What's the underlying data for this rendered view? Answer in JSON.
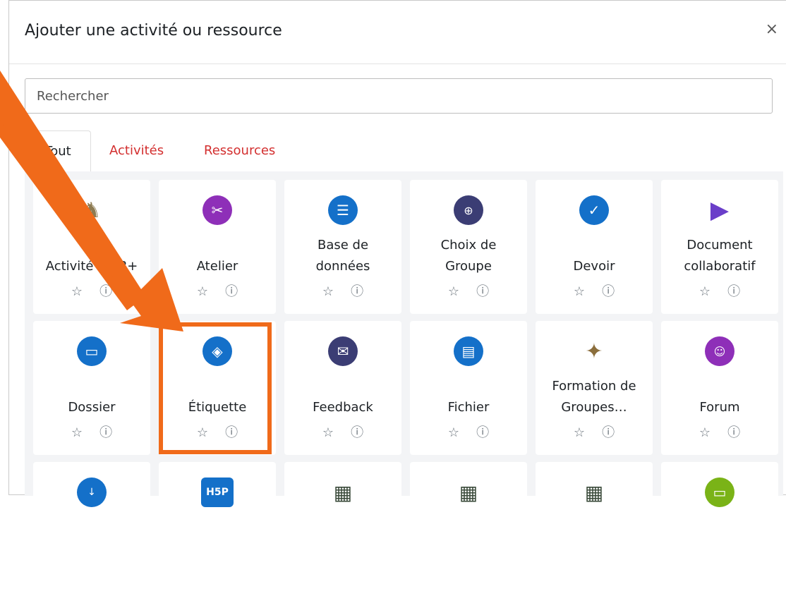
{
  "dialog": {
    "title": "Ajouter une activité ou ressource",
    "close_glyph": "×",
    "search_placeholder": "Rechercher"
  },
  "tabs": [
    {
      "label": "Tout",
      "active": true
    },
    {
      "label": "Activités",
      "active": false
    },
    {
      "label": "Ressources",
      "active": false
    }
  ],
  "row1": [
    {
      "label": "Activité OMB+",
      "icon": "omb-figure-icon",
      "color": "#8d7b52"
    },
    {
      "label": "Atelier",
      "icon": "workshop-tools-icon",
      "color": "#8e2fb8"
    },
    {
      "label": "Base de données",
      "icon": "database-icon",
      "color": "#1470c9"
    },
    {
      "label": "Choix de Groupe",
      "icon": "group-choice-icon",
      "color": "#3b3d74"
    },
    {
      "label": "Devoir",
      "icon": "assignment-icon",
      "color": "#1470c9"
    },
    {
      "label": "Document collaboratif",
      "icon": "collab-doc-icon",
      "color": "#6a3ec9"
    }
  ],
  "row2": [
    {
      "label": "Dossier",
      "icon": "folder-icon",
      "color": "#1470c9"
    },
    {
      "label": "Étiquette",
      "icon": "label-tag-icon",
      "color": "#1470c9"
    },
    {
      "label": "Feedback",
      "icon": "feedback-icon",
      "color": "#3b3d74"
    },
    {
      "label": "Fichier",
      "icon": "file-icon",
      "color": "#1470c9"
    },
    {
      "label": "Formation de Groupes…",
      "icon": "group-formation-icon",
      "color": "#8b6e3c"
    },
    {
      "label": "Forum",
      "icon": "forum-icon",
      "color": "#8e2fb8"
    }
  ],
  "row3": [
    {
      "icon": "glossary-sort-icon",
      "color": "#1470c9"
    },
    {
      "icon": "h5p-icon",
      "color": "#1470c9"
    },
    {
      "icon": "checkerboard-icon",
      "color": "#3a4a3a"
    },
    {
      "icon": "checkerboard-icon",
      "color": "#3a4a3a"
    },
    {
      "icon": "checkerboard-icon",
      "color": "#3a4a3a"
    },
    {
      "icon": "monitor-icon",
      "color": "#7ab317"
    }
  ],
  "actions": {
    "star_glyph": "☆",
    "info_glyph": "ⓘ"
  },
  "annotation": {
    "arrow_color": "#f06a1a",
    "highlight_color": "#f06a1a"
  }
}
